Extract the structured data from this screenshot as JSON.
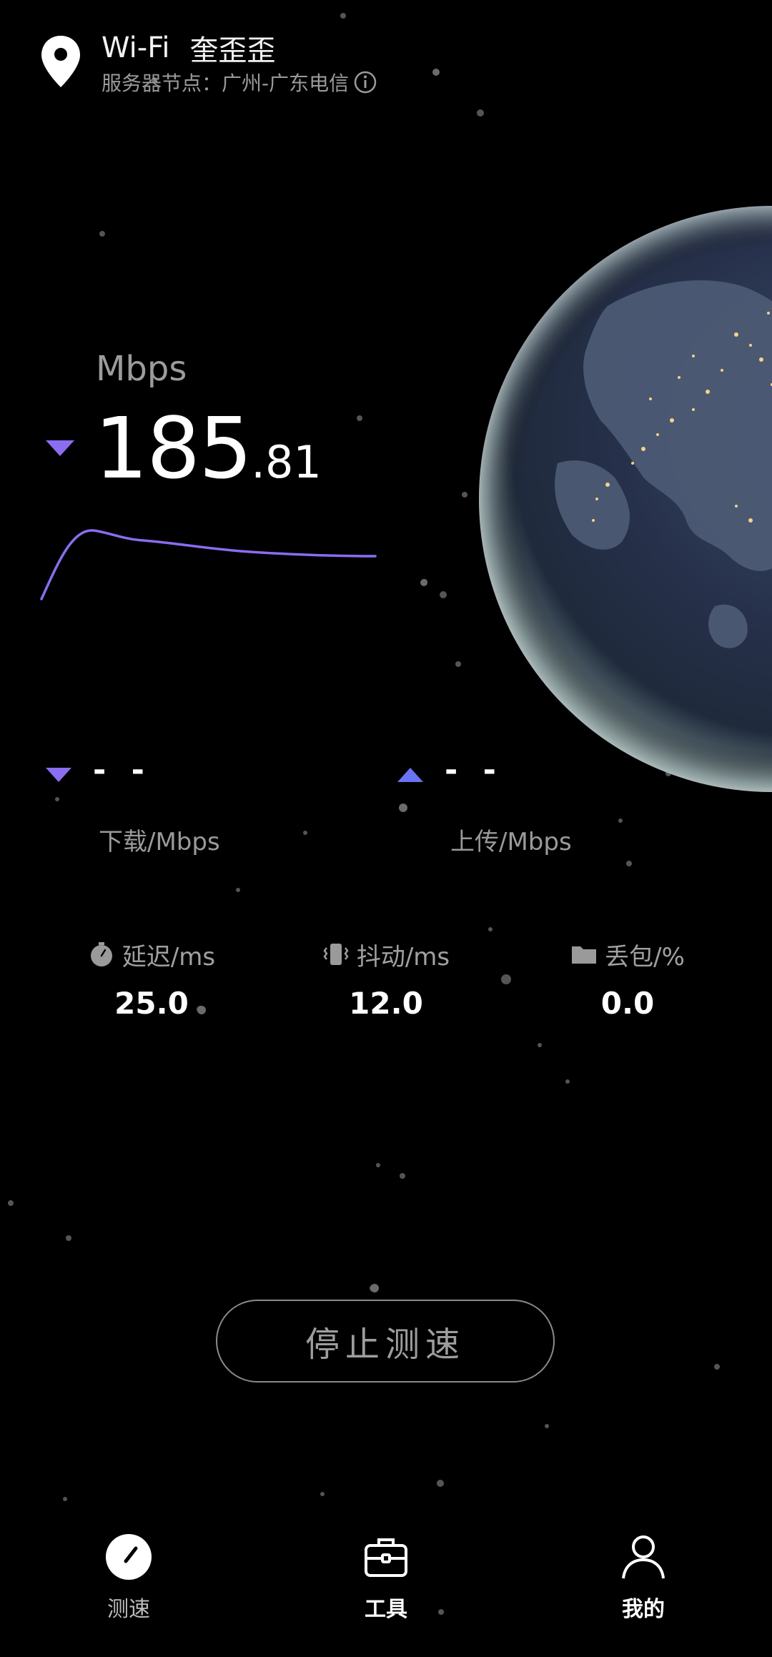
{
  "header": {
    "network_type": "Wi-Fi",
    "network_name": "奎歪歪",
    "server_label": "服务器节点：",
    "server_value": "广州-广东电信",
    "location_icon": "location-pin-icon",
    "info_icon": "info-circle-icon"
  },
  "speed": {
    "unit": "Mbps",
    "value_integer": "185",
    "value_decimal": ".81",
    "direction_icon": "download-triangle-icon"
  },
  "results": {
    "download": {
      "value": "- -",
      "label": "下载/Mbps",
      "icon": "download-triangle-icon"
    },
    "upload": {
      "value": "- -",
      "label": "上传/Mbps",
      "icon": "upload-triangle-icon"
    }
  },
  "metrics": [
    {
      "label": "延迟/ms",
      "value": "25.0",
      "icon": "timer-icon"
    },
    {
      "label": "抖动/ms",
      "value": "12.0",
      "icon": "vibration-icon"
    },
    {
      "label": "丢包/%",
      "value": "0.0",
      "icon": "folder-icon"
    }
  ],
  "stop_button": {
    "label": "停止测速"
  },
  "tabs": [
    {
      "label": "测速",
      "icon": "speedometer-icon",
      "active": true
    },
    {
      "label": "工具",
      "icon": "toolbox-icon",
      "active": false
    },
    {
      "label": "我的",
      "icon": "person-icon",
      "active": false
    }
  ],
  "colors": {
    "background": "#000000",
    "accent_purple": "#8a6df0",
    "upload_blue": "#6b73f5",
    "text_primary": "#ffffff",
    "text_secondary": "#9a9a9a"
  }
}
